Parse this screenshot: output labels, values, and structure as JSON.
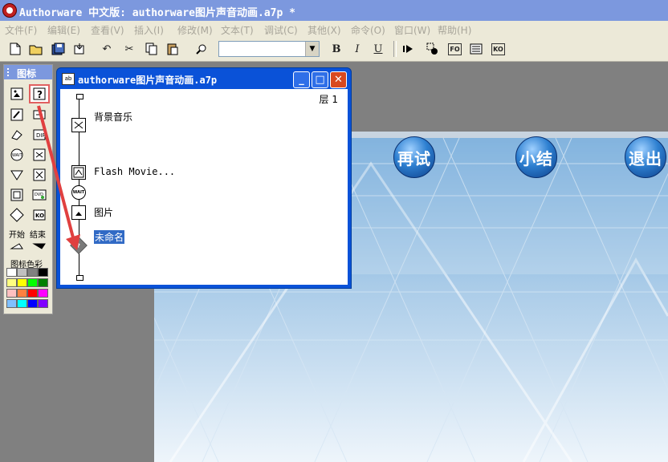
{
  "window": {
    "title": "Authorware 中文版: authorware图片声音动画.a7p *"
  },
  "menu": [
    "文件(F)",
    "编辑(E)",
    "查看(V)",
    "插入(I)",
    "修改(M)",
    "文本(T)",
    "调试(C)",
    "其他(X)",
    "命令(O)",
    "窗口(W)",
    "帮助(H)"
  ],
  "toolbar": {
    "font_value": "",
    "bold": "B",
    "italic": "I",
    "underline": "U",
    "fo_label": "FO",
    "ko_label": "KO"
  },
  "palette": {
    "title": "图标",
    "start_label": "开始",
    "end_label": "结束",
    "color_label": "图标色彩",
    "icons": [
      "display-icon",
      "interaction-icon",
      "calculation-icon",
      "map-icon",
      "erase-icon",
      "digital-movie-icon",
      "wait-icon",
      "sound-icon",
      "navigate-icon",
      "video-icon",
      "framework-icon",
      "decision-icon",
      "knowledge-object-icon",
      "motion-icon",
      "dvd-icon",
      "ko-icon"
    ],
    "colors": [
      "#ffffff",
      "#c0c0c0",
      "#808080",
      "#000000",
      "#ffff80",
      "#ffff00",
      "#00ff00",
      "#008000",
      "#ffc0c0",
      "#ff8040",
      "#ff0000",
      "#ff00ff",
      "#80c0ff",
      "#00ffff",
      "#0000ff",
      "#8000ff"
    ]
  },
  "flow_window": {
    "title": "authorware图片声音动画.a7p",
    "level": "层 1",
    "items": [
      {
        "label": "背景音乐",
        "icon": "sound-icon"
      },
      {
        "label": "Flash Movie...",
        "icon": "flash-icon"
      },
      {
        "label": "",
        "icon": "wait-icon"
      },
      {
        "label": "图片",
        "icon": "display-icon"
      },
      {
        "label": "未命名",
        "icon": "interaction-icon"
      }
    ]
  },
  "stage": {
    "buttons": [
      "再试",
      "小结",
      "退出"
    ]
  },
  "colors": {
    "titlebar": "#7c98de",
    "flow_titlebar": "#0a52d8",
    "annotation_arrow": "#e04040"
  }
}
